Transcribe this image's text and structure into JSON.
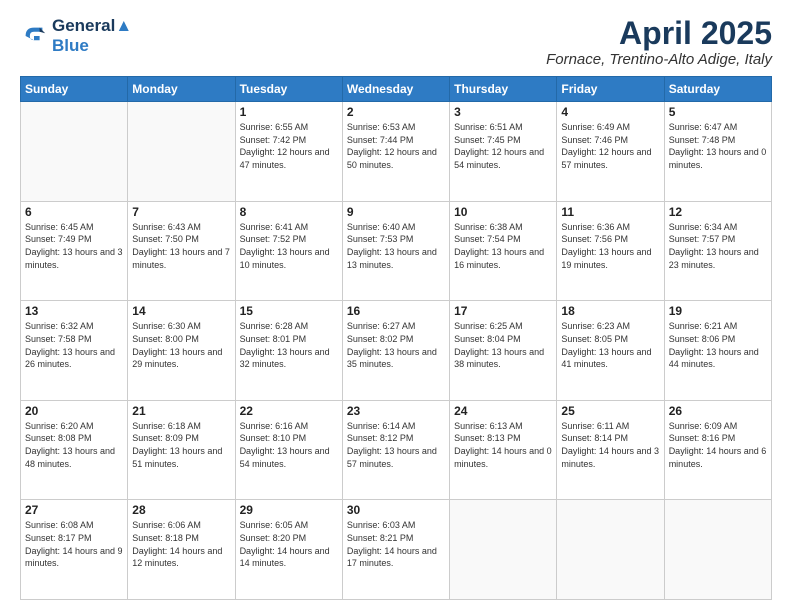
{
  "header": {
    "logo_line1": "General",
    "logo_line2": "Blue",
    "month": "April 2025",
    "location": "Fornace, Trentino-Alto Adige, Italy"
  },
  "weekdays": [
    "Sunday",
    "Monday",
    "Tuesday",
    "Wednesday",
    "Thursday",
    "Friday",
    "Saturday"
  ],
  "weeks": [
    [
      {
        "day": "",
        "info": ""
      },
      {
        "day": "",
        "info": ""
      },
      {
        "day": "1",
        "info": "Sunrise: 6:55 AM\nSunset: 7:42 PM\nDaylight: 12 hours and 47 minutes."
      },
      {
        "day": "2",
        "info": "Sunrise: 6:53 AM\nSunset: 7:44 PM\nDaylight: 12 hours and 50 minutes."
      },
      {
        "day": "3",
        "info": "Sunrise: 6:51 AM\nSunset: 7:45 PM\nDaylight: 12 hours and 54 minutes."
      },
      {
        "day": "4",
        "info": "Sunrise: 6:49 AM\nSunset: 7:46 PM\nDaylight: 12 hours and 57 minutes."
      },
      {
        "day": "5",
        "info": "Sunrise: 6:47 AM\nSunset: 7:48 PM\nDaylight: 13 hours and 0 minutes."
      }
    ],
    [
      {
        "day": "6",
        "info": "Sunrise: 6:45 AM\nSunset: 7:49 PM\nDaylight: 13 hours and 3 minutes."
      },
      {
        "day": "7",
        "info": "Sunrise: 6:43 AM\nSunset: 7:50 PM\nDaylight: 13 hours and 7 minutes."
      },
      {
        "day": "8",
        "info": "Sunrise: 6:41 AM\nSunset: 7:52 PM\nDaylight: 13 hours and 10 minutes."
      },
      {
        "day": "9",
        "info": "Sunrise: 6:40 AM\nSunset: 7:53 PM\nDaylight: 13 hours and 13 minutes."
      },
      {
        "day": "10",
        "info": "Sunrise: 6:38 AM\nSunset: 7:54 PM\nDaylight: 13 hours and 16 minutes."
      },
      {
        "day": "11",
        "info": "Sunrise: 6:36 AM\nSunset: 7:56 PM\nDaylight: 13 hours and 19 minutes."
      },
      {
        "day": "12",
        "info": "Sunrise: 6:34 AM\nSunset: 7:57 PM\nDaylight: 13 hours and 23 minutes."
      }
    ],
    [
      {
        "day": "13",
        "info": "Sunrise: 6:32 AM\nSunset: 7:58 PM\nDaylight: 13 hours and 26 minutes."
      },
      {
        "day": "14",
        "info": "Sunrise: 6:30 AM\nSunset: 8:00 PM\nDaylight: 13 hours and 29 minutes."
      },
      {
        "day": "15",
        "info": "Sunrise: 6:28 AM\nSunset: 8:01 PM\nDaylight: 13 hours and 32 minutes."
      },
      {
        "day": "16",
        "info": "Sunrise: 6:27 AM\nSunset: 8:02 PM\nDaylight: 13 hours and 35 minutes."
      },
      {
        "day": "17",
        "info": "Sunrise: 6:25 AM\nSunset: 8:04 PM\nDaylight: 13 hours and 38 minutes."
      },
      {
        "day": "18",
        "info": "Sunrise: 6:23 AM\nSunset: 8:05 PM\nDaylight: 13 hours and 41 minutes."
      },
      {
        "day": "19",
        "info": "Sunrise: 6:21 AM\nSunset: 8:06 PM\nDaylight: 13 hours and 44 minutes."
      }
    ],
    [
      {
        "day": "20",
        "info": "Sunrise: 6:20 AM\nSunset: 8:08 PM\nDaylight: 13 hours and 48 minutes."
      },
      {
        "day": "21",
        "info": "Sunrise: 6:18 AM\nSunset: 8:09 PM\nDaylight: 13 hours and 51 minutes."
      },
      {
        "day": "22",
        "info": "Sunrise: 6:16 AM\nSunset: 8:10 PM\nDaylight: 13 hours and 54 minutes."
      },
      {
        "day": "23",
        "info": "Sunrise: 6:14 AM\nSunset: 8:12 PM\nDaylight: 13 hours and 57 minutes."
      },
      {
        "day": "24",
        "info": "Sunrise: 6:13 AM\nSunset: 8:13 PM\nDaylight: 14 hours and 0 minutes."
      },
      {
        "day": "25",
        "info": "Sunrise: 6:11 AM\nSunset: 8:14 PM\nDaylight: 14 hours and 3 minutes."
      },
      {
        "day": "26",
        "info": "Sunrise: 6:09 AM\nSunset: 8:16 PM\nDaylight: 14 hours and 6 minutes."
      }
    ],
    [
      {
        "day": "27",
        "info": "Sunrise: 6:08 AM\nSunset: 8:17 PM\nDaylight: 14 hours and 9 minutes."
      },
      {
        "day": "28",
        "info": "Sunrise: 6:06 AM\nSunset: 8:18 PM\nDaylight: 14 hours and 12 minutes."
      },
      {
        "day": "29",
        "info": "Sunrise: 6:05 AM\nSunset: 8:20 PM\nDaylight: 14 hours and 14 minutes."
      },
      {
        "day": "30",
        "info": "Sunrise: 6:03 AM\nSunset: 8:21 PM\nDaylight: 14 hours and 17 minutes."
      },
      {
        "day": "",
        "info": ""
      },
      {
        "day": "",
        "info": ""
      },
      {
        "day": "",
        "info": ""
      }
    ]
  ]
}
